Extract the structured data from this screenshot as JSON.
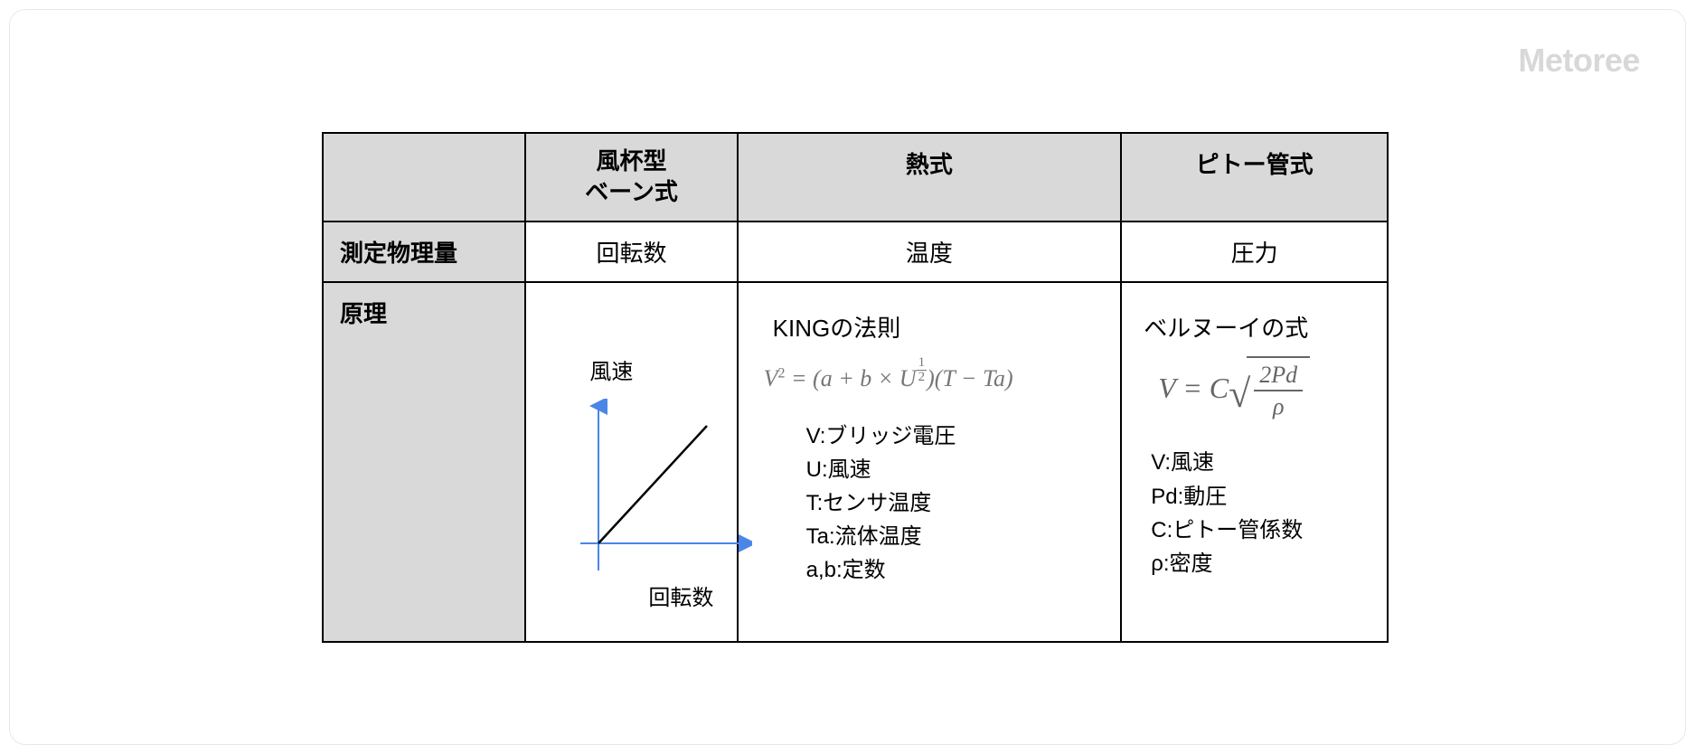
{
  "watermark": "Metoree",
  "headers": {
    "cup": "風杯型\nベーン式",
    "heat": "熱式",
    "pitot": "ピトー管式"
  },
  "rows": {
    "measured": {
      "label": "測定物理量",
      "cup": "回転数",
      "heat": "温度",
      "pitot": "圧力"
    },
    "principle": {
      "label": "原理"
    }
  },
  "cup_principle": {
    "y_label": "風速",
    "x_label": "回転数"
  },
  "heat_principle": {
    "title": "KINGの法則",
    "formula_plain": "V^2 = (a + b × U^(1/2))(T − Ta)",
    "legend": [
      "V:ブリッジ電圧",
      "U:風速",
      "T:センサ温度",
      "Ta:流体温度",
      "a,b:定数"
    ]
  },
  "pitot_principle": {
    "title": "ベルヌーイの式",
    "formula_plain": "V = C √(2Pd / ρ)",
    "legend": [
      "V:風速",
      "Pd:動圧",
      "C:ピトー管係数",
      "ρ:密度"
    ]
  }
}
